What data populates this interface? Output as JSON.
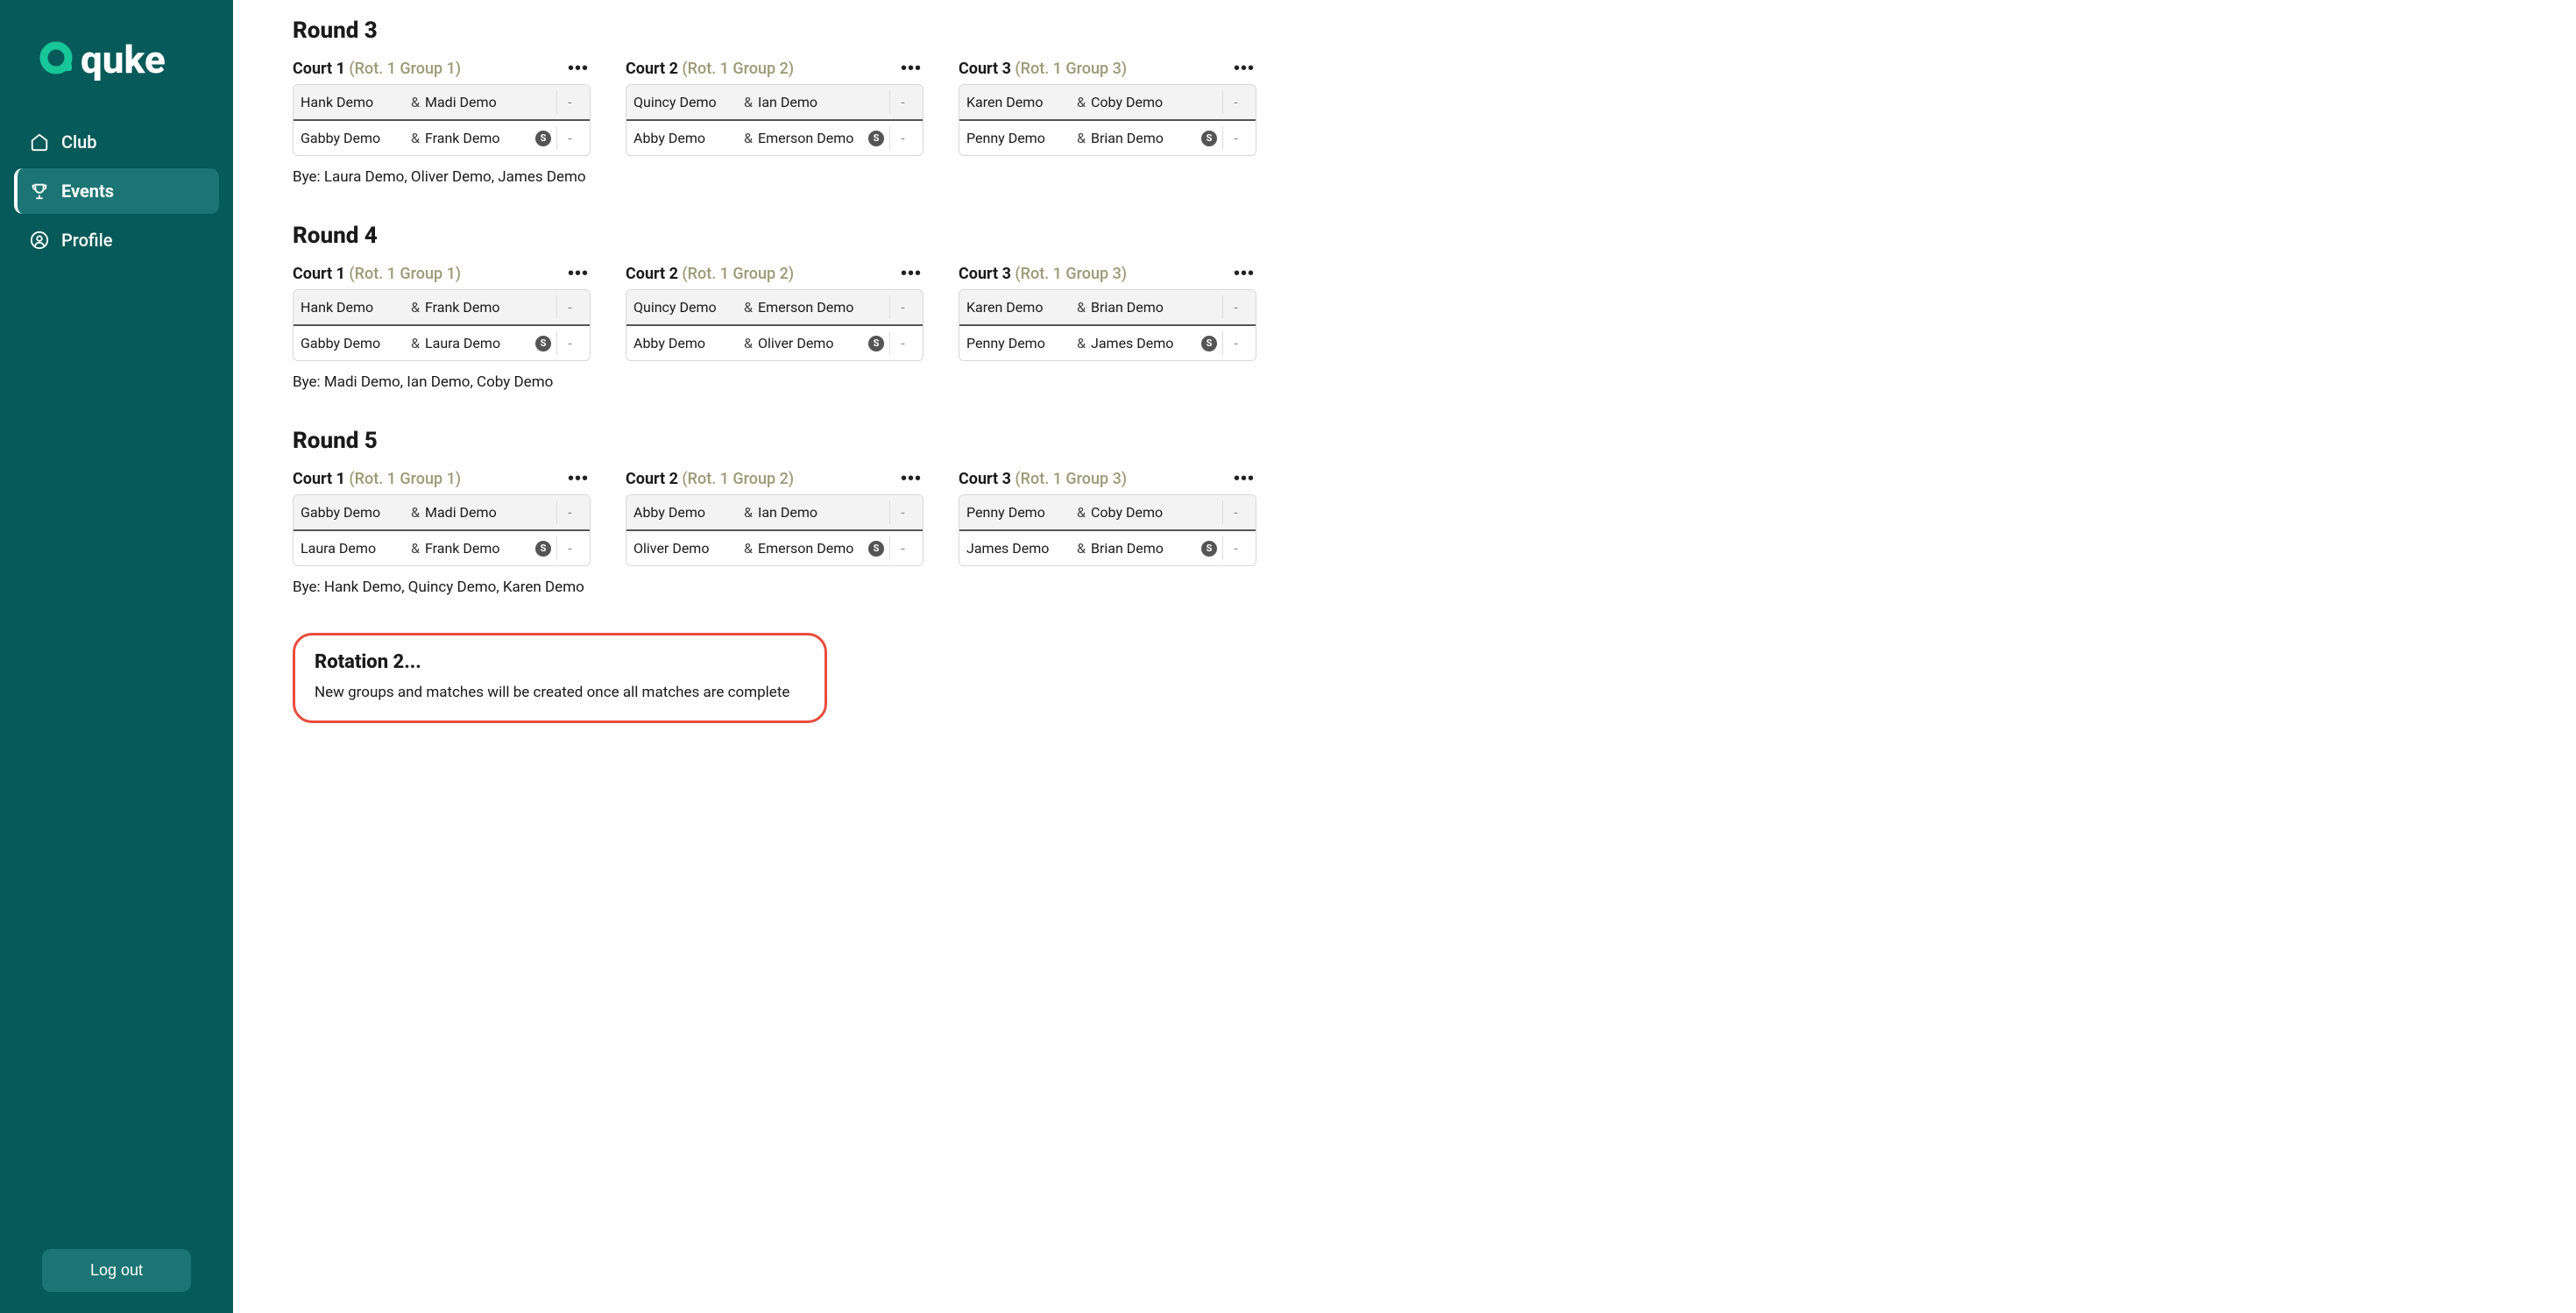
{
  "brand": {
    "name": "quke"
  },
  "sidebar": {
    "items": [
      {
        "label": "Club"
      },
      {
        "label": "Events"
      },
      {
        "label": "Profile"
      }
    ],
    "logout_label": "Log out"
  },
  "rounds": [
    {
      "title": "Round 3",
      "courts": [
        {
          "name": "Court 1",
          "group": "(Rot. 1 Group 1)",
          "row1": {
            "p1": "Hank Demo",
            "p2": "Madi Demo",
            "badge": "",
            "score": "-"
          },
          "row2": {
            "p1": "Gabby Demo",
            "p2": "Frank Demo",
            "badge": "S",
            "score": "-"
          }
        },
        {
          "name": "Court 2",
          "group": "(Rot. 1 Group 2)",
          "row1": {
            "p1": "Quincy Demo",
            "p2": "Ian Demo",
            "badge": "",
            "score": "-"
          },
          "row2": {
            "p1": "Abby Demo",
            "p2": "Emerson Demo",
            "badge": "S",
            "score": "-"
          }
        },
        {
          "name": "Court 3",
          "group": "(Rot. 1 Group 3)",
          "row1": {
            "p1": "Karen Demo",
            "p2": "Coby Demo",
            "badge": "",
            "score": "-"
          },
          "row2": {
            "p1": "Penny Demo",
            "p2": "Brian Demo",
            "badge": "S",
            "score": "-"
          }
        }
      ],
      "bye": "Bye: Laura Demo, Oliver Demo, James Demo"
    },
    {
      "title": "Round 4",
      "courts": [
        {
          "name": "Court 1",
          "group": "(Rot. 1 Group 1)",
          "row1": {
            "p1": "Hank Demo",
            "p2": "Frank Demo",
            "badge": "",
            "score": "-"
          },
          "row2": {
            "p1": "Gabby Demo",
            "p2": "Laura Demo",
            "badge": "S",
            "score": "-"
          }
        },
        {
          "name": "Court 2",
          "group": "(Rot. 1 Group 2)",
          "row1": {
            "p1": "Quincy Demo",
            "p2": "Emerson Demo",
            "badge": "",
            "score": "-"
          },
          "row2": {
            "p1": "Abby Demo",
            "p2": "Oliver Demo",
            "badge": "S",
            "score": "-"
          }
        },
        {
          "name": "Court 3",
          "group": "(Rot. 1 Group 3)",
          "row1": {
            "p1": "Karen Demo",
            "p2": "Brian Demo",
            "badge": "",
            "score": "-"
          },
          "row2": {
            "p1": "Penny Demo",
            "p2": "James Demo",
            "badge": "S",
            "score": "-"
          }
        }
      ],
      "bye": "Bye: Madi Demo, Ian Demo, Coby Demo"
    },
    {
      "title": "Round 5",
      "courts": [
        {
          "name": "Court 1",
          "group": "(Rot. 1 Group 1)",
          "row1": {
            "p1": "Gabby Demo",
            "p2": "Madi Demo",
            "badge": "",
            "score": "-"
          },
          "row2": {
            "p1": "Laura Demo",
            "p2": "Frank Demo",
            "badge": "S",
            "score": "-"
          }
        },
        {
          "name": "Court 2",
          "group": "(Rot. 1 Group 2)",
          "row1": {
            "p1": "Abby Demo",
            "p2": "Ian Demo",
            "badge": "",
            "score": "-"
          },
          "row2": {
            "p1": "Oliver Demo",
            "p2": "Emerson Demo",
            "badge": "S",
            "score": "-"
          }
        },
        {
          "name": "Court 3",
          "group": "(Rot. 1 Group 3)",
          "row1": {
            "p1": "Penny Demo",
            "p2": "Coby Demo",
            "badge": "",
            "score": "-"
          },
          "row2": {
            "p1": "James Demo",
            "p2": "Brian Demo",
            "badge": "S",
            "score": "-"
          }
        }
      ],
      "bye": "Bye: Hank Demo, Quincy Demo, Karen Demo"
    }
  ],
  "rotation_callout": {
    "title": "Rotation 2...",
    "text": "New groups and matches will be created once all matches are complete"
  }
}
